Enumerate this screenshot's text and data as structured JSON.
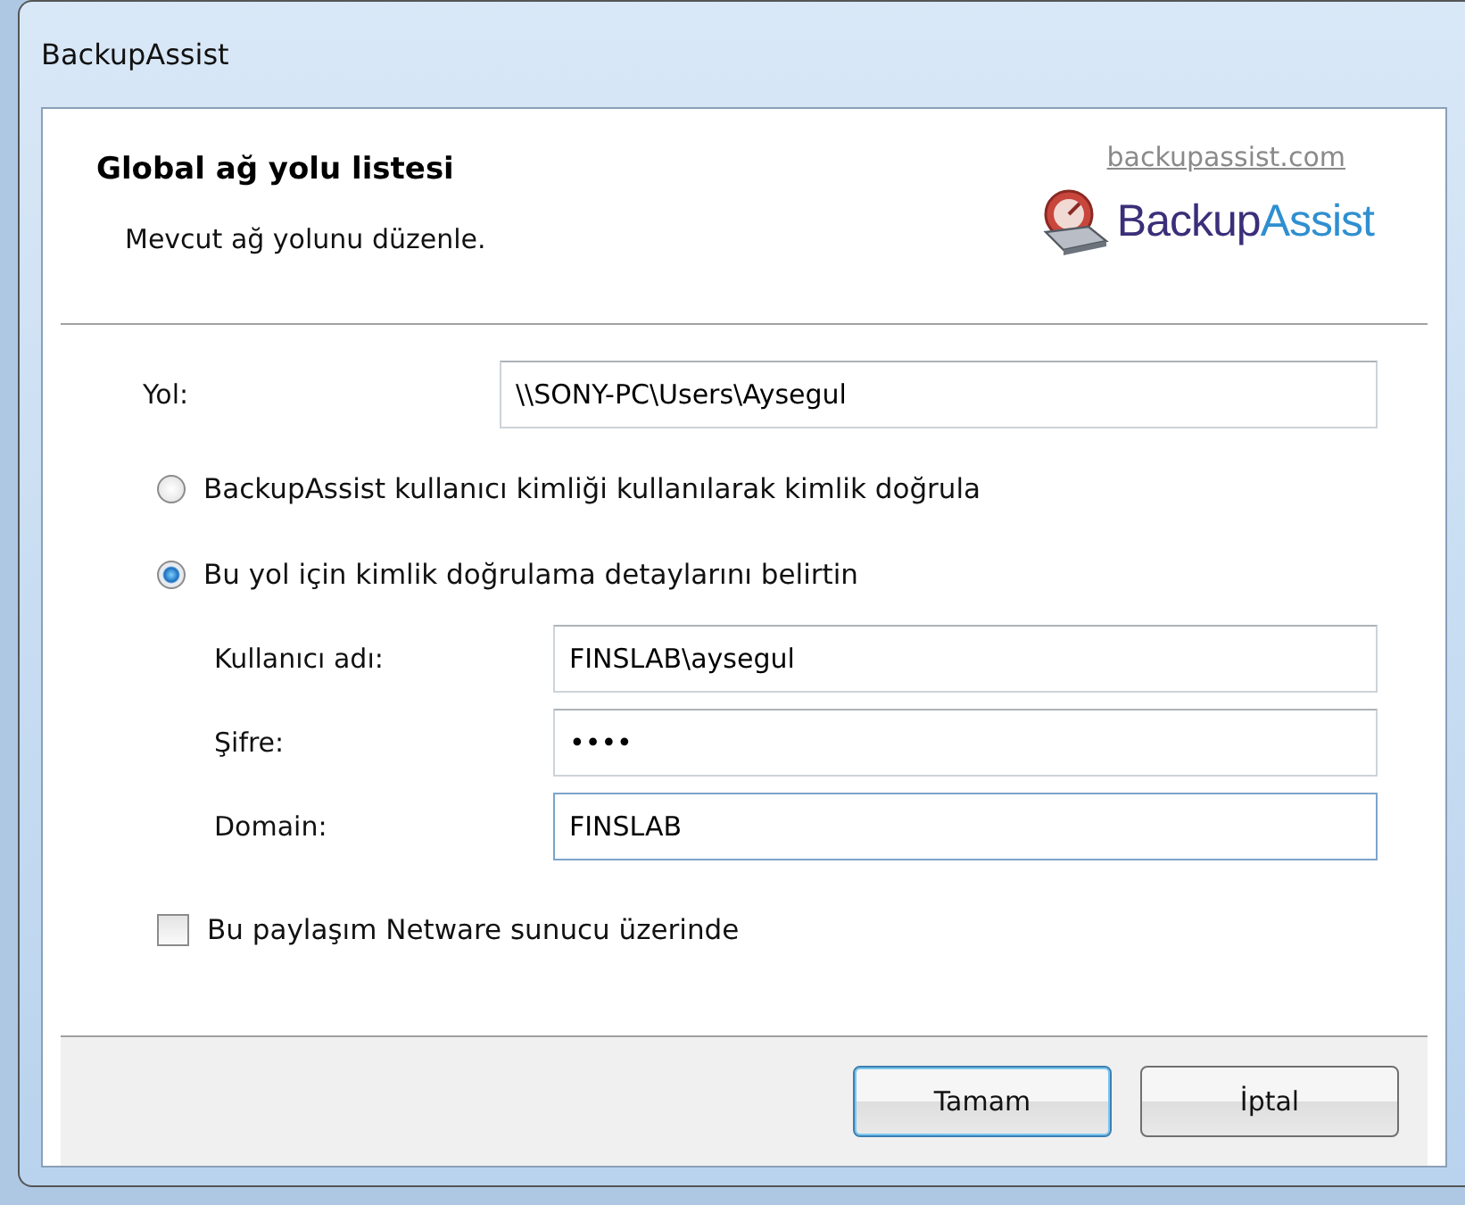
{
  "window": {
    "title": "BackupAssist"
  },
  "header": {
    "title": "Global ağ yolu listesi",
    "subtitle": "Mevcut ağ yolunu düzenle.",
    "link": "backupassist.com",
    "logo": [
      "Backup",
      "Assist"
    ]
  },
  "path": {
    "label": "Yol:",
    "value": "\\\\SONY-PC\\Users\\Aysegul"
  },
  "auth_options": [
    {
      "label": "BackupAssist kullanıcı kimliği kullanılarak kimlik doğrula",
      "selected": false
    },
    {
      "label": "Bu yol için kimlik doğrulama detaylarını belirtin",
      "selected": true
    }
  ],
  "credentials": [
    {
      "label": "Kullanıcı adı:",
      "value": "FINSLAB\\aysegul",
      "focused": false
    },
    {
      "label": "Şifre:",
      "value": "••••",
      "focused": false
    },
    {
      "label": "Domain:",
      "value": "FINSLAB",
      "focused": true
    }
  ],
  "netware": {
    "label": "Bu paylaşım Netware sunucu üzerinde",
    "checked": false
  },
  "buttons": [
    {
      "label": "Tamam",
      "default": true
    },
    {
      "label": "İptal",
      "default": false
    }
  ]
}
